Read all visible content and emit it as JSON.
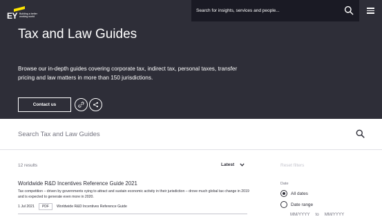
{
  "brand": {
    "logo_text": "EY",
    "tagline": "Building a better working world"
  },
  "header": {
    "search_placeholder": "Search for insights, services and people..."
  },
  "hero": {
    "title": "Tax and Law Guides",
    "description": "Browse our in-depth guides covering corporate tax, indirect tax, personal taxes, transfer pricing and law matters in more than 150 jurisdictions.",
    "contact_label": "Contact us"
  },
  "search": {
    "placeholder": "Search Tax and Law Guides"
  },
  "results": {
    "count": "12 results",
    "sort_label": "Latest",
    "reset_label": "Reset filters",
    "items": [
      {
        "title": "Worldwide R&D Incentives Reference Guide 2021",
        "description": "Tax competition – driven by governments vying to attract and sustain economic activity in their jurisdiction – drove much global tax change in 2019 and is expected to generate even more in 2020.",
        "date": "1 Jul 2021",
        "type": "PDF",
        "filename": "Worldwide R&D Incentives Reference Guide"
      }
    ]
  },
  "filters": {
    "date_label": "Date",
    "options": [
      "All dates",
      "Date range"
    ],
    "selected": "All dates",
    "from_placeholder": "MM/YYYY",
    "to_label": "to",
    "to_placeholder": "MM/YYYY"
  },
  "colors": {
    "hero_bg": "#2e2e38",
    "accent": "#ffe600",
    "search_dark": "#1a1a24"
  }
}
